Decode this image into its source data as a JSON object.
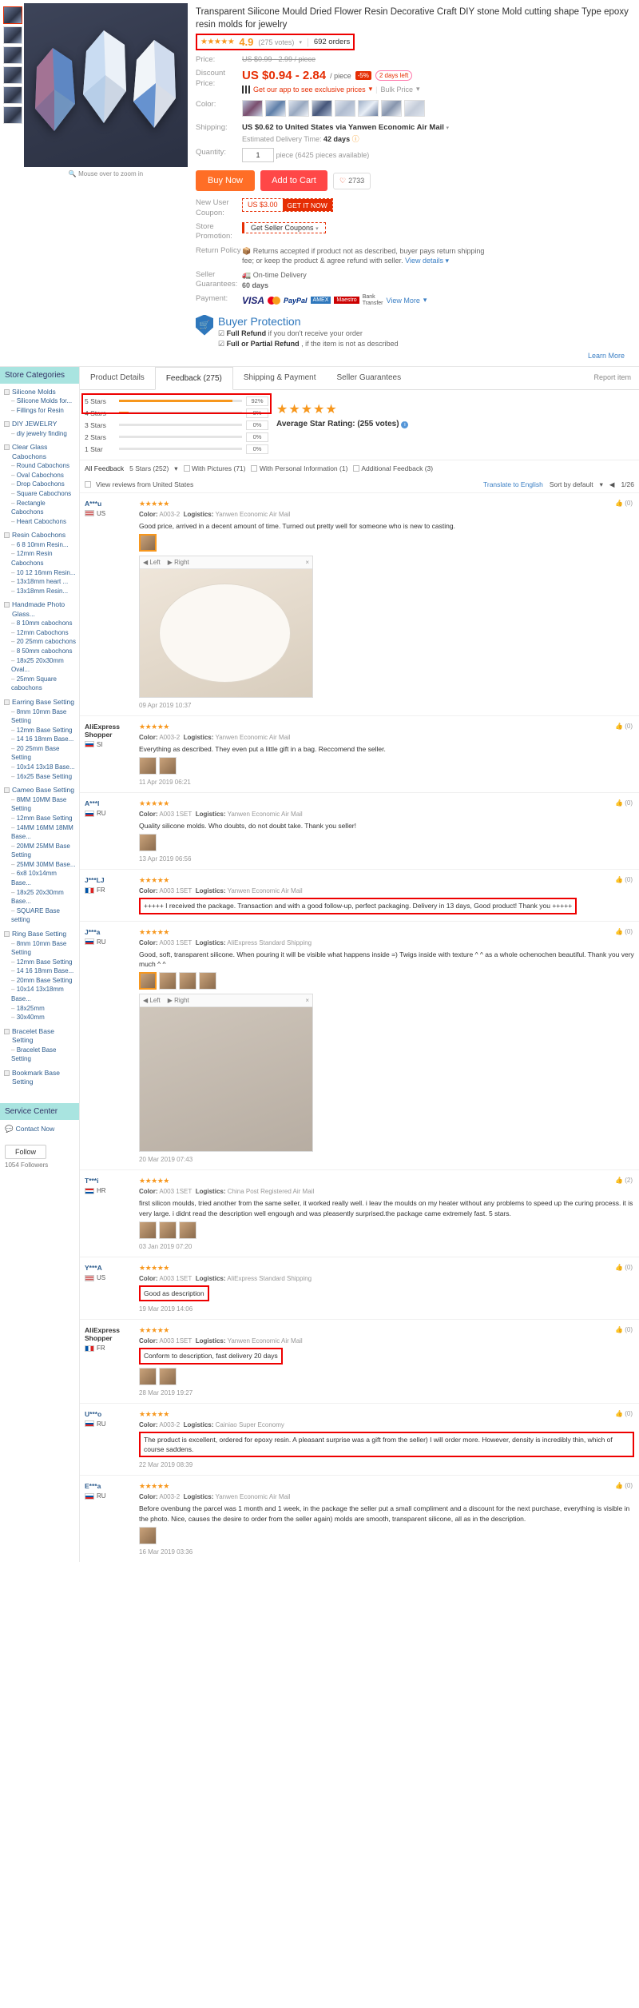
{
  "product": {
    "title": "Transparent Silicone Mould Dried Flower Resin Decorative Craft DIY stone Mold cutting shape Type epoxy resin molds for jewelry",
    "rating": "4.9",
    "votes": "(275 votes)",
    "orders": "692 orders",
    "stars": "★★★★★",
    "price_label": "Price:",
    "price_old": "US $0.99 - 2.99 / piece",
    "discount_label_1": "Discount",
    "discount_label_2": "Price:",
    "price_new": "US $0.94 - 2.84",
    "price_unit": "/ piece",
    "discount_badge": "-5%",
    "days_left": "2 days left",
    "app_promo": "Get our app to see exclusive prices",
    "bulk_price": "Bulk Price",
    "color_label": "Color:",
    "shipping_label": "Shipping:",
    "shipping_value": "US $0.62 to United States via Yanwen Economic Air Mail",
    "edt_label": "Estimated Delivery Time:",
    "edt_value": "42 days",
    "quantity_label": "Quantity:",
    "quantity_value": "1",
    "quantity_note": "piece (6425 pieces available)",
    "buy_now": "Buy Now",
    "add_to_cart": "Add to Cart",
    "wish_count": "2733",
    "new_user_coupon_label_1": "New User",
    "new_user_coupon_label_2": "Coupon:",
    "coupon_amount": "US $3.00",
    "coupon_get": "GET IT NOW",
    "store_promo_label_1": "Store",
    "store_promo_label_2": "Promotion:",
    "store_promo_value": "Get Seller Coupons",
    "return_policy_label": "Return Policy",
    "return_policy_line1": "Returns accepted if product not as described, buyer pays return shipping",
    "return_policy_line2": "fee; or keep the product & agree refund with seller.",
    "return_policy_link": "View details",
    "seller_guar_label_1": "Seller",
    "seller_guar_label_2": "Guarantees:",
    "seller_guar_line1": "On-time Delivery",
    "seller_guar_line2": "60 days",
    "payment_label": "Payment:",
    "payment_methods": [
      "VISA",
      "Mastercard",
      "PayPal",
      "American Express",
      "Maestro",
      "Bank Transfer"
    ],
    "payment_view_more": "View More",
    "buyer_protection_title": "Buyer Protection",
    "bp_line1_bold": "Full Refund",
    "bp_line1_rest": "if you don't receive your order",
    "bp_line2_bold": "Full or Partial Refund",
    "bp_line2_rest": ", if the item is not as described",
    "learn_more": "Learn More",
    "zoom_hint": "Mouse over to zoom in"
  },
  "sidebar": {
    "store_categories_title": "Store Categories",
    "groups": [
      {
        "name": "Silicone Molds",
        "subs": [
          "Silicone Molds for...",
          "Fillings for Resin"
        ]
      },
      {
        "name": "DIY JEWELRY",
        "subs": [
          "diy jewelry finding"
        ]
      },
      {
        "name": "Clear Glass Cabochons",
        "subs": [
          "Round Cabochons",
          "Oval Cabochons",
          "Drop Cabochons",
          "Square Cabochons",
          "Rectangle Cabochons",
          "Heart Cabochons"
        ]
      },
      {
        "name": "Resin Cabochons",
        "subs": [
          "6 8 10mm Resin...",
          "12mm Resin Cabochons",
          "10 12 16mm Resin...",
          "13x18mm heart ...",
          "13x18mm Resin..."
        ]
      },
      {
        "name": "Handmade Photo Glass...",
        "subs": [
          "8 10mm cabochons",
          "12mm Cabochons",
          "20 25mm cabochons",
          "8 50mm cabochons",
          "18x25 20x30mm Oval...",
          "25mm Square cabochons"
        ]
      },
      {
        "name": "Earring Base Setting",
        "subs": [
          "8mm 10mm Base Setting",
          "12mm Base Setting",
          "14 16 18mm Base...",
          "20 25mm Base Setting",
          "10x14 13x18 Base...",
          "16x25 Base Setting"
        ]
      },
      {
        "name": "Cameo Base Setting",
        "subs": [
          "8MM 10MM Base Setting",
          "12mm Base Setting",
          "14MM 16MM 18MM Base...",
          "20MM 25MM Base Setting",
          "25MM 30MM Base...",
          "6x8 10x14mm Base...",
          "18x25 20x30mm Base...",
          "SQUARE Base setting"
        ]
      },
      {
        "name": "Ring Base Setting",
        "subs": [
          "8mm 10mm Base Setting",
          "12mm Base Setting",
          "14 16 18mm Base...",
          "20mm Base Setting",
          "10x14 13x18mm Base...",
          "18x25mm",
          "30x40mm"
        ]
      },
      {
        "name": "Bracelet Base Setting",
        "subs": [
          "Bracelet Base Setting"
        ]
      },
      {
        "name": "Bookmark Base Setting",
        "subs": []
      }
    ],
    "service_center_title": "Service Center",
    "contact_now": "Contact Now",
    "follow_button": "Follow",
    "followers": "1054 Followers"
  },
  "tabs": [
    {
      "label": "Product Details",
      "active": false
    },
    {
      "label": "Feedback (275)",
      "active": true
    },
    {
      "label": "Shipping & Payment",
      "active": false
    },
    {
      "label": "Seller Guarantees",
      "active": false
    }
  ],
  "report_item": "Report item",
  "feedback": {
    "bars": [
      {
        "label": "5 Stars",
        "pct": "92%",
        "value": 92
      },
      {
        "label": "4 Stars",
        "pct": "8%",
        "value": 8
      },
      {
        "label": "3 Stars",
        "pct": "0%",
        "value": 0
      },
      {
        "label": "2 Stars",
        "pct": "0%",
        "value": 0
      },
      {
        "label": "1 Star",
        "pct": "0%",
        "value": 0
      }
    ],
    "avg_stars": "★★★★★",
    "avg_label": "Average Star Rating:",
    "avg_votes": "(255 votes)",
    "filter_all": "All Feedback",
    "filter_stars": "5 Stars (252)",
    "filter_pictures": "With Pictures (71)",
    "filter_personal": "With Personal Information (1)",
    "filter_additional": "Additional Feedback (3)",
    "reviews_from": "View reviews from United States",
    "translate": "Translate to English",
    "sort": "Sort by default",
    "page": "1/26"
  },
  "reviews": [
    {
      "user": "A***u",
      "country": "US",
      "flag": "f-us",
      "stars": "★★★★★",
      "color_label": "Color:",
      "color": "A003-2",
      "logistics_label": "Logistics:",
      "logistics": "Yanwen Economic Air Mail",
      "text": "Good price, arrived in a decent amount of time. Turned out pretty well for someone who is new to casting.",
      "date": "09 Apr 2019 10:37",
      "helpful": "(0)",
      "photo_caption_left": "Left",
      "photo_caption_right": "Right",
      "has_photo": true,
      "has_thumb": true
    },
    {
      "user": "AliExpress Shopper",
      "country": "SI",
      "flag": "f-si",
      "stars": "★★★★★",
      "color_label": "Color:",
      "color": "A003-2",
      "logistics_label": "Logistics:",
      "logistics": "Yanwen Economic Air Mail",
      "text": "Everything as described. They even put a little gift in a bag. Reccomend the seller.",
      "date": "11 Apr 2019 06:21",
      "helpful": "(0)",
      "has_thumbs2": true
    },
    {
      "user": "A***l",
      "country": "RU",
      "flag": "f-ru",
      "stars": "★★★★★",
      "color_label": "Color:",
      "color": "A003 1SET",
      "logistics_label": "Logistics:",
      "logistics": "Yanwen Economic Air Mail",
      "text": "Quality silicone molds. Who doubts, do not doubt take. Thank you seller!",
      "date": "13 Apr 2019 06:56",
      "helpful": "(0)",
      "has_thumb1": true
    },
    {
      "user": "J***LJ",
      "country": "FR",
      "flag": "f-fr",
      "stars": "★★★★★",
      "color_label": "Color:",
      "color": "A003 1SET",
      "logistics_label": "Logistics:",
      "logistics": "Yanwen Economic Air Mail",
      "text": "+++++ I received the package. Transaction and with a good follow-up, perfect packaging. Delivery in 13 days, Good product! Thank you +++++",
      "date": "",
      "helpful": "(0)",
      "boxed": true
    },
    {
      "user": "J***a",
      "country": "RU",
      "flag": "f-ru",
      "stars": "★★★★★",
      "color_label": "Color:",
      "color": "A003 1SET",
      "logistics_label": "Logistics:",
      "logistics": "AliExpress Standard Shipping",
      "text": "Good, soft, transparent silicone. When pouring it will be visible what happens inside =) Twigs inside with texture ^ ^ as a whole ochenochen beautiful. Thank you very much ^ ^",
      "date": "20 Mar 2019 07:43",
      "helpful": "(0)",
      "has_photo2": true,
      "has_thumbs4": true,
      "photo_caption_left": "Left",
      "photo_caption_right": "Right"
    },
    {
      "user": "T***i",
      "country": "HR",
      "flag": "f-hr",
      "stars": "★★★★★",
      "color_label": "Color:",
      "color": "A003 1SET",
      "logistics_label": "Logistics:",
      "logistics": "China Post Registered Air Mail",
      "text": "first silicon moulds, tried another from the same seller, it worked really well. i leav the moulds on my heater without any problems to speed up the curing process. it is very large. i didnt read the description well engough and was pleasently surprised.the package came extremely fast. 5 stars.",
      "date": "03 Jan 2019 07:20",
      "helpful": "(2)",
      "has_thumbs3": true
    },
    {
      "user": "Y***A",
      "country": "US",
      "flag": "f-us",
      "stars": "★★★★★",
      "color_label": "Color:",
      "color": "A003 1SET",
      "logistics_label": "Logistics:",
      "logistics": "AliExpress Standard Shipping",
      "text": "Good as description",
      "date": "19 Mar 2019 14:06",
      "helpful": "(0)",
      "boxed": true
    },
    {
      "user": "AliExpress Shopper",
      "country": "FR",
      "flag": "f-fr",
      "stars": "★★★★★",
      "color_label": "Color:",
      "color": "A003 1SET",
      "logistics_label": "Logistics:",
      "logistics": "Yanwen Economic Air Mail",
      "text": "Conform to description, fast delivery 20 days",
      "date": "28 Mar 2019 19:27",
      "helpful": "(0)",
      "boxed": true,
      "has_thumbs2b": true
    },
    {
      "user": "U***o",
      "country": "RU",
      "flag": "f-ru",
      "stars": "★★★★★",
      "color_label": "Color:",
      "color": "A003-2",
      "logistics_label": "Logistics:",
      "logistics": "Cainiao Super Economy",
      "text": "The product is excellent, ordered for epoxy resin. A pleasant surprise was a gift from the seller) I will order more. However, density is incredibly thin, which of course saddens.",
      "date": "22 Mar 2019 08:39",
      "helpful": "(0)",
      "boxed": true
    },
    {
      "user": "E***a",
      "country": "RU",
      "flag": "f-ru",
      "stars": "★★★★★",
      "color_label": "Color:",
      "color": "A003-2",
      "logistics_label": "Logistics:",
      "logistics": "Yanwen Economic Air Mail",
      "text": "Before ovenbung the parcel was 1 month and 1 week, in the package the seller put a small compliment and a discount for the next purchase, everything is visible in the photo. Nice, causes the desire to order from the seller again) molds are smooth, transparent silicone, all as in the description.",
      "date": "16 Mar 2019 03:36",
      "helpful": "(0)",
      "has_thumb1b": true
    }
  ]
}
